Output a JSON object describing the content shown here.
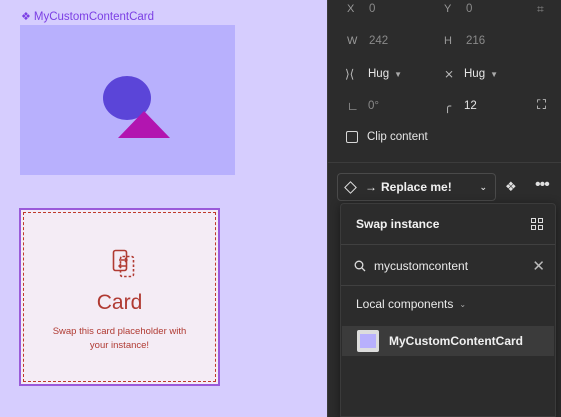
{
  "canvas": {
    "component_label": "MyCustomContentCard",
    "placeholder": {
      "title": "Card",
      "description": "Swap this card placeholder with your instance!"
    },
    "colors": {
      "canvas_bg": "#d6cdfe",
      "component_fill": "#b8b0fd",
      "circle": "#5b45d8",
      "triangle": "#b215b0",
      "placeholder_accent": "#b03a32"
    }
  },
  "properties": {
    "x": {
      "label": "X",
      "value": "0"
    },
    "y": {
      "label": "Y",
      "value": "0"
    },
    "w": {
      "label": "W",
      "value": "242"
    },
    "h": {
      "label": "H",
      "value": "216"
    },
    "width_mode": "Hug",
    "height_mode": "Hug",
    "rotation": "0°",
    "corner_radius": "12",
    "clip_content_label": "Clip content"
  },
  "instance": {
    "arrow": "→",
    "name": "Replace me!"
  },
  "swap_popover": {
    "title": "Swap instance",
    "search_value": "mycustomcontent",
    "section_label": "Local components",
    "results": [
      {
        "name": "MyCustomContentCard"
      }
    ]
  },
  "icons": [
    "component-icon",
    "swap-icon",
    "constraints-icon",
    "rotation-icon",
    "radius-icon",
    "expand-corners-icon",
    "instance-diamond-icon",
    "component-set-icon",
    "more-icon",
    "grid-icon",
    "search-icon",
    "close-icon",
    "chevron-down-icon"
  ]
}
